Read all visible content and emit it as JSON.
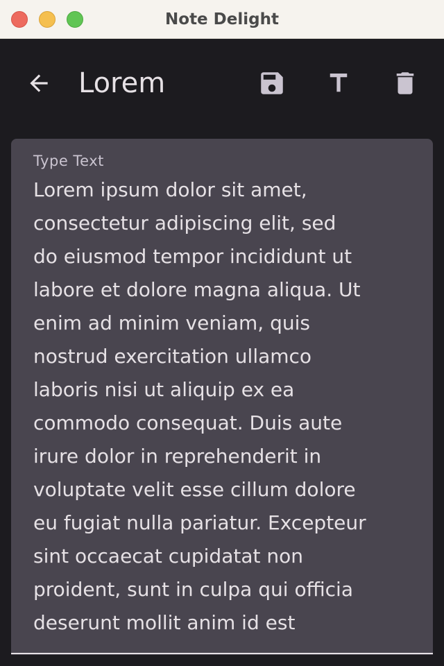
{
  "window": {
    "title": "Note Delight"
  },
  "appbar": {
    "title": "Lorem",
    "icons": {
      "back": "arrow-back-icon",
      "save": "save-icon",
      "text": "text-format-icon",
      "delete": "delete-icon"
    }
  },
  "note": {
    "label": "Type Text",
    "text": "Lorem ipsum dolor sit amet,\nconsectetur adipiscing elit, sed\ndo eiusmod tempor incididunt ut\nlabore et dolore magna aliqua. Ut\nenim ad minim veniam, quis\nnostrud exercitation ullamco\nlaboris nisi ut aliquip ex ea\ncommodo consequat. Duis aute\nirure dolor in reprehenderit in\nvoluptate velit esse cillum dolore\neu fugiat nulla pariatur. Excepteur\nsint occaecat cupidatat non\nproident, sunt in culpa qui officia\ndeserunt mollit anim id est"
  },
  "colors": {
    "background": "#1c1b1f",
    "surface_variant": "#49454f",
    "on_surface": "#e6e1e5",
    "label": "#cac4d0",
    "titlebar": "#f6f3ee",
    "traffic_close": "#ed6a5e",
    "traffic_minimize": "#f5bf4f",
    "traffic_zoom": "#61c554"
  }
}
